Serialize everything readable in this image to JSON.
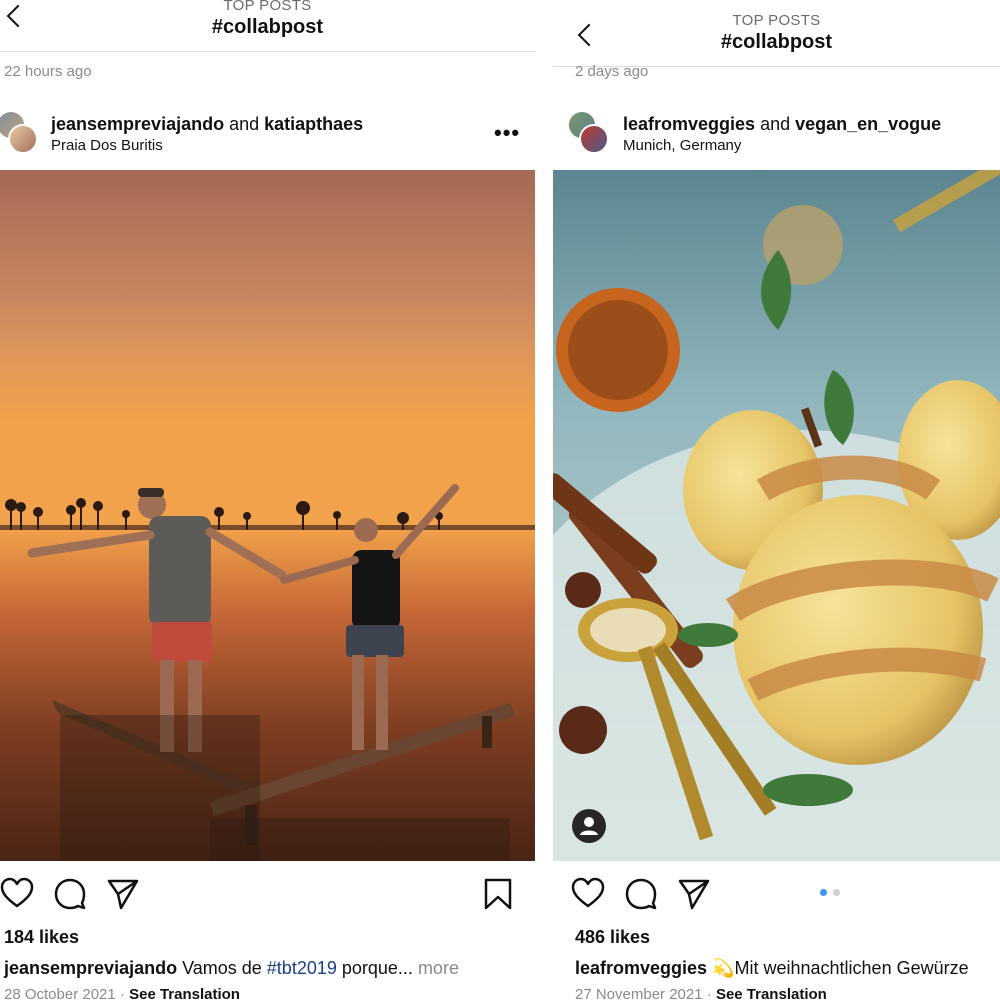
{
  "left_post": {
    "header": {
      "subtitle": "TOP POSTS",
      "title": "#collabpost"
    },
    "previous_post_time": "22 hours ago",
    "owner": {
      "first": "jeansempreviajando",
      "joiner": " and ",
      "second": "katiapthaes"
    },
    "location": "Praia Dos Buritis",
    "options_label": "•••",
    "likes": "184 likes",
    "caption": {
      "username": "jeansempreviajando",
      "text_before": " Vamos de ",
      "hashtag": "#tbt2019",
      "text_after": " porque...",
      "more": " more"
    },
    "date": "28 October 2021",
    "separator": " · ",
    "see_translation": "See Translation"
  },
  "right_post": {
    "header": {
      "subtitle": "TOP POSTS",
      "title": "#collabpost"
    },
    "previous_post_time": "2 days ago",
    "owner": {
      "first": "leafromveggies",
      "joiner": " and ",
      "second": "vegan_en_vogue"
    },
    "location": "Munich, Germany",
    "likes": "486 likes",
    "caption": {
      "username": "leafromveggies",
      "emoji": "💫",
      "text": "Mit weihnachtlichen Gewürze"
    },
    "date": "27 November 2021",
    "separator": " · ",
    "see_translation": "See Translation",
    "carousel": {
      "current": 1,
      "total": 2
    }
  },
  "icons": [
    "back-chevron-icon",
    "heart-icon",
    "comment-icon",
    "share-icon",
    "bookmark-icon",
    "tagged-user-icon",
    "more-options-icon"
  ],
  "colors": {
    "accent_blue": "#3897f0",
    "hashtag": "#1d3f87",
    "muted": "#8a8a8a",
    "divider": "#dbdbdb"
  }
}
